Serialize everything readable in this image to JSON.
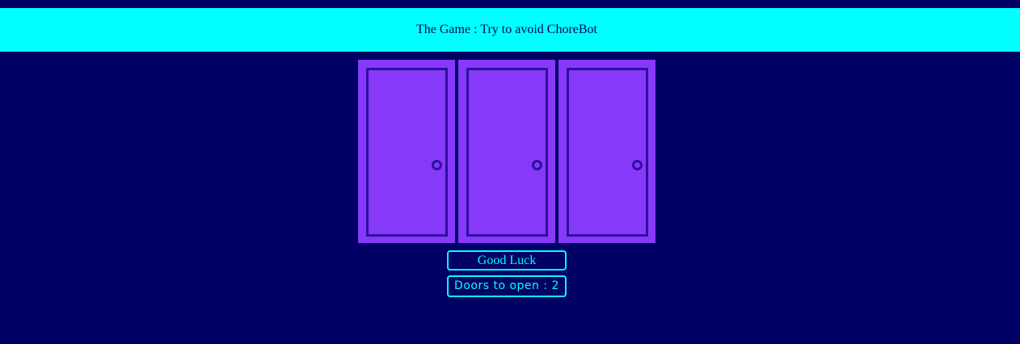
{
  "header": {
    "title": "The Game : Try to avoid ChoreBot"
  },
  "doors": [
    {
      "label": "Door 1",
      "state": "closed"
    },
    {
      "label": "Door 2",
      "state": "closed"
    },
    {
      "label": "Door 3",
      "state": "closed"
    }
  ],
  "status": {
    "button_label": "Good Luck",
    "doors_to_open": "Doors to open : 2"
  },
  "colors": {
    "background": "#010165",
    "header": "#00ffff",
    "door": "#8739f9",
    "door_outline": "#2e0fa0",
    "accent": "#00ffff"
  }
}
